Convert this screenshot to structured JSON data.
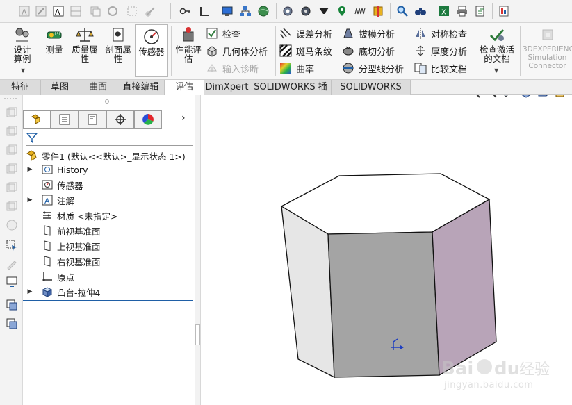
{
  "ribbon": {
    "design_calc": "设计算例",
    "measure": "测量",
    "mass_props": "质量属性",
    "section_props": "剖面属性",
    "sensor": "传感器",
    "perf_eval": "性能评估",
    "check": "检查",
    "geometry_analysis": "几何体分析",
    "import_diag": "输入诊断",
    "deviation": "误差分析",
    "zebra": "斑马条纹",
    "curvature": "曲率",
    "draft": "拔模分析",
    "undercut": "底切分析",
    "parting_line": "分型线分析",
    "symmetry": "对称检查",
    "thickness": "厚度分析",
    "compare": "比较文档",
    "check_active": "检查激活的文档",
    "connector": "3DEXPERIENCE Simulation Connector"
  },
  "tabs": [
    "特征",
    "草图",
    "曲面",
    "直接编辑",
    "评估",
    "DimXpert",
    "SOLIDWORKS 插件",
    "SOLIDWORKS MBD"
  ],
  "tree": {
    "root": "零件1  (默认<<默认>_显示状态 1>)",
    "items": [
      {
        "label": "History",
        "expandable": true
      },
      {
        "label": "传感器",
        "expandable": false
      },
      {
        "label": "注解",
        "expandable": true
      },
      {
        "label": "材质 <未指定>",
        "expandable": false
      },
      {
        "label": "前视基准面",
        "expandable": false
      },
      {
        "label": "上视基准面",
        "expandable": false
      },
      {
        "label": "右视基准面",
        "expandable": false
      },
      {
        "label": "原点",
        "expandable": false
      },
      {
        "label": "凸台-拉伸4",
        "expandable": true
      }
    ]
  },
  "colors": {
    "accent_red": "#e0262a",
    "highlight_blue": "#1f5fa6",
    "prism_top": "#ffffff",
    "prism_left": "#e6e6e6",
    "prism_front": "#a4a4a4",
    "prism_right": "#b8a4b8"
  },
  "watermark": {
    "logo_text": "Bai du 经验",
    "url": "jingyan.baidu.com"
  }
}
